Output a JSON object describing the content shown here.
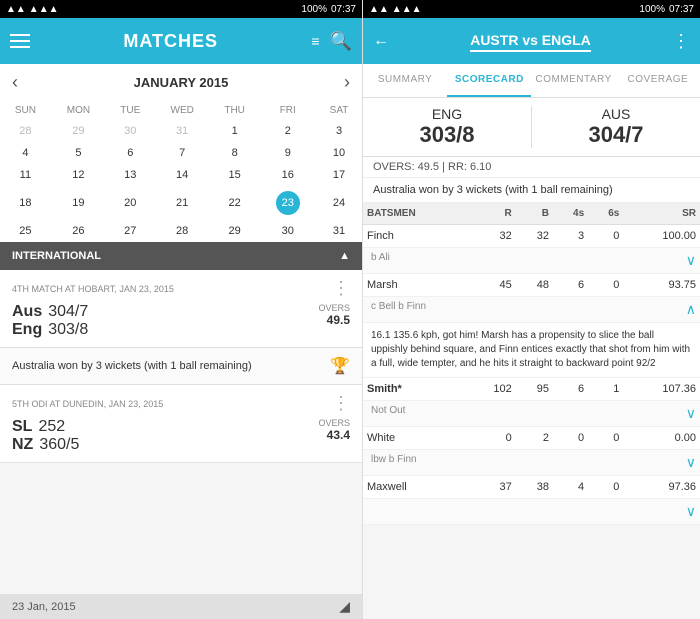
{
  "left": {
    "statusBar": {
      "signal": "▲▲▲",
      "battery": "100%",
      "time": "07:37"
    },
    "header": {
      "title": "MATCHES",
      "searchIcon": "🔍"
    },
    "calendar": {
      "month": "JANUARY 2015",
      "weekdays": [
        "SUN",
        "MON",
        "TUE",
        "WED",
        "THU",
        "FRI",
        "SAT"
      ],
      "rows": [
        [
          "28",
          "29",
          "30",
          "31",
          "1",
          "2",
          "3"
        ],
        [
          "4",
          "5",
          "6",
          "7",
          "8",
          "9",
          "10"
        ],
        [
          "11",
          "12",
          "13",
          "14",
          "15",
          "16",
          "17"
        ],
        [
          "18",
          "19",
          "20",
          "21",
          "22",
          "23",
          "24"
        ],
        [
          "25",
          "26",
          "27",
          "28",
          "29",
          "30",
          "31"
        ]
      ],
      "todayDate": "23",
      "todayRow": 3,
      "todayCol": 5
    },
    "section": {
      "label": "INTERNATIONAL"
    },
    "match1": {
      "meta": "4TH MATCH AT HOBART, JAN 23, 2015",
      "team1": "Aus",
      "score1": "304/7",
      "team2": "Eng",
      "score2": "303/8",
      "overs": "OVERS 49.5",
      "result": "Australia won by 3 wickets (with 1 ball remaining)"
    },
    "match2": {
      "meta": "5TH ODI AT DUNEDIN, JAN 23, 2015",
      "team1": "SL",
      "score1": "252",
      "team2": "NZ",
      "score2": "360/5",
      "overs": "OVERS 43.4"
    },
    "footer": {
      "date": "23 Jan, 2015"
    }
  },
  "right": {
    "statusBar": {
      "signal": "▲▲▲",
      "battery": "100%",
      "time": "07:37"
    },
    "header": {
      "title": "AUSTR vs ENGLA"
    },
    "tabs": [
      {
        "label": "SUMMARY",
        "active": false
      },
      {
        "label": "SCORECARD",
        "active": true
      },
      {
        "label": "COMMENTARY",
        "active": false
      },
      {
        "label": "COVERAGE",
        "active": false
      }
    ],
    "scoreHeader": {
      "team1": "ENG",
      "score1": "303/8",
      "team2": "AUS",
      "score2": "304/7"
    },
    "infoBar": "OVERS: 49.5  |  RR: 6.10",
    "resultBar": "Australia won by 3 wickets (with 1 ball remaining)",
    "tableHeaders": [
      "BATSMEN",
      "R",
      "B",
      "4s",
      "6s",
      "SR"
    ],
    "batsmen": [
      {
        "name": "Finch",
        "dismissal": "b Ali",
        "r": "32",
        "b": "32",
        "fours": "3",
        "sixes": "0",
        "sr": "100.00",
        "expanded": false
      },
      {
        "name": "Marsh",
        "dismissal": "c Bell b Finn",
        "r": "45",
        "b": "48",
        "fours": "6",
        "sixes": "0",
        "sr": "93.75",
        "expanded": true,
        "expandText": "16.1 135.6 kph, got him! Marsh has a propensity to slice the ball uppishly behind square, and Finn entices exactly that shot from him with a full, wide tempter, and he hits it straight to backward point 92/2"
      },
      {
        "name": "Smith*",
        "dismissal": "Not Out",
        "r": "102",
        "b": "95",
        "fours": "6",
        "sixes": "1",
        "sr": "107.36",
        "expanded": false
      },
      {
        "name": "White",
        "dismissal": "lbw b Finn",
        "r": "0",
        "b": "2",
        "fours": "0",
        "sixes": "0",
        "sr": "0.00",
        "expanded": false
      },
      {
        "name": "Maxwell",
        "dismissal": "",
        "r": "37",
        "b": "38",
        "fours": "4",
        "sixes": "0",
        "sr": "97.36",
        "expanded": false
      }
    ]
  }
}
